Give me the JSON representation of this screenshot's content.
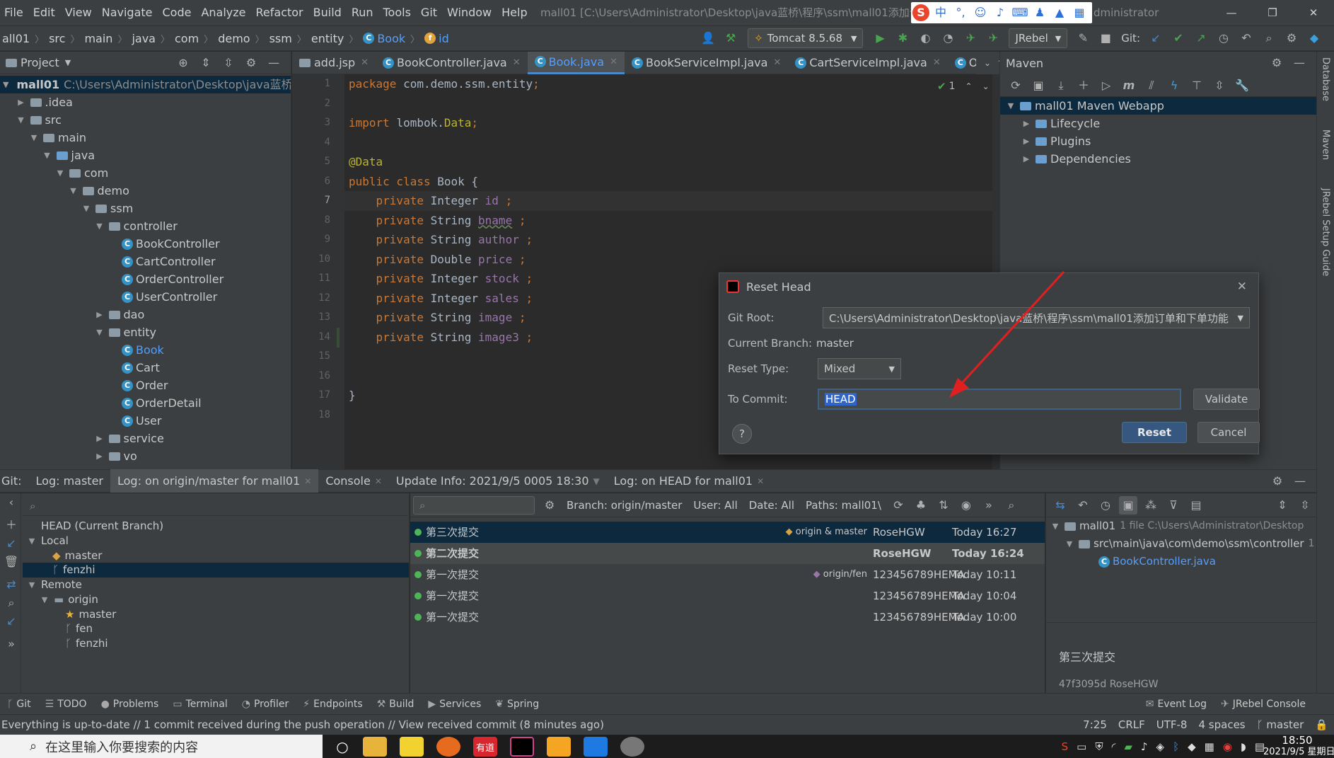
{
  "menubar": {
    "items": [
      "File",
      "Edit",
      "View",
      "Navigate",
      "Code",
      "Analyze",
      "Refactor",
      "Build",
      "Run",
      "Tools",
      "Git",
      "Window",
      "Help"
    ],
    "title": "mall01 [C:\\Users\\Administrator\\Desktop\\java蓝桥\\程序\\ssm\\mall01添加订",
    "title_tail": "dministrator",
    "ime": {
      "logo": "S",
      "lang": "中",
      "punct": "°,"
    }
  },
  "navbar": {
    "crumbs": [
      "all01",
      "src",
      "main",
      "java",
      "com",
      "demo",
      "ssm",
      "entity",
      "Book",
      "id"
    ],
    "run_config": "Tomcat 8.5.68",
    "jrebel": "JRebel",
    "git_label": "Git:"
  },
  "project": {
    "header": "Project",
    "tree": [
      {
        "label": "mall01",
        "path": "C:\\Users\\Administrator\\Desktop\\java蓝桥\\",
        "level": 0,
        "arrow": "▼",
        "kind": "folder",
        "selected": true,
        "bold": true
      },
      {
        "label": ".idea",
        "level": 1,
        "arrow": "▶",
        "kind": "folder"
      },
      {
        "label": "src",
        "level": 1,
        "arrow": "▼",
        "kind": "folder"
      },
      {
        "label": "main",
        "level": 2,
        "arrow": "▼",
        "kind": "folder"
      },
      {
        "label": "java",
        "level": 3,
        "arrow": "▼",
        "kind": "folder-blue"
      },
      {
        "label": "com",
        "level": 4,
        "arrow": "▼",
        "kind": "folder"
      },
      {
        "label": "demo",
        "level": 5,
        "arrow": "▼",
        "kind": "folder"
      },
      {
        "label": "ssm",
        "level": 6,
        "arrow": "▼",
        "kind": "folder"
      },
      {
        "label": "controller",
        "level": 7,
        "arrow": "▼",
        "kind": "folder"
      },
      {
        "label": "BookController",
        "level": 8,
        "arrow": "",
        "kind": "class"
      },
      {
        "label": "CartController",
        "level": 8,
        "arrow": "",
        "kind": "class"
      },
      {
        "label": "OrderController",
        "level": 8,
        "arrow": "",
        "kind": "class"
      },
      {
        "label": "UserController",
        "level": 8,
        "arrow": "",
        "kind": "class"
      },
      {
        "label": "dao",
        "level": 7,
        "arrow": "▶",
        "kind": "folder"
      },
      {
        "label": "entity",
        "level": 7,
        "arrow": "▼",
        "kind": "folder"
      },
      {
        "label": "Book",
        "level": 8,
        "arrow": "",
        "kind": "class",
        "blue": true
      },
      {
        "label": "Cart",
        "level": 8,
        "arrow": "",
        "kind": "class"
      },
      {
        "label": "Order",
        "level": 8,
        "arrow": "",
        "kind": "class"
      },
      {
        "label": "OrderDetail",
        "level": 8,
        "arrow": "",
        "kind": "class"
      },
      {
        "label": "User",
        "level": 8,
        "arrow": "",
        "kind": "class"
      },
      {
        "label": "service",
        "level": 7,
        "arrow": "▶",
        "kind": "folder"
      },
      {
        "label": "vo",
        "level": 7,
        "arrow": "▶",
        "kind": "folder"
      }
    ]
  },
  "editor": {
    "tabs": [
      {
        "label": "add.jsp",
        "active": false
      },
      {
        "label": "BookController.java",
        "active": false
      },
      {
        "label": "Book.java",
        "active": true
      },
      {
        "label": "BookServiceImpl.java",
        "active": false
      },
      {
        "label": "CartServiceImpl.java",
        "active": false
      },
      {
        "label": "Order",
        "active": false
      }
    ],
    "inspection_count": "1",
    "lines": [
      {
        "n": "1",
        "parts": [
          [
            "kw",
            "package "
          ],
          [
            "",
            "com.demo.ssm.entity"
          ],
          [
            "kw",
            ";"
          ]
        ]
      },
      {
        "n": "2",
        "parts": []
      },
      {
        "n": "3",
        "parts": [
          [
            "kw",
            "import "
          ],
          [
            "",
            "lombok."
          ],
          [
            "ann",
            "Data"
          ],
          [
            "kw",
            ";"
          ]
        ]
      },
      {
        "n": "4",
        "parts": []
      },
      {
        "n": "5",
        "parts": [
          [
            "ann",
            "@Data"
          ]
        ]
      },
      {
        "n": "6",
        "parts": [
          [
            "kw",
            "public class "
          ],
          [
            "",
            "Book {"
          ]
        ]
      },
      {
        "n": "7",
        "parts": [
          [
            "kw",
            "    private "
          ],
          [
            "",
            "Integer "
          ],
          [
            "fld",
            "id "
          ],
          [
            "kw",
            ";"
          ]
        ],
        "current": true
      },
      {
        "n": "8",
        "parts": [
          [
            "kw",
            "    private "
          ],
          [
            "",
            "String "
          ],
          [
            "fld sq",
            "bname"
          ],
          [
            "kw",
            " ;"
          ]
        ]
      },
      {
        "n": "9",
        "parts": [
          [
            "kw",
            "    private "
          ],
          [
            "",
            "String "
          ],
          [
            "fld",
            "author "
          ],
          [
            "kw",
            ";"
          ]
        ]
      },
      {
        "n": "10",
        "parts": [
          [
            "kw",
            "    private "
          ],
          [
            "",
            "Double "
          ],
          [
            "fld",
            "price "
          ],
          [
            "kw",
            ";"
          ]
        ]
      },
      {
        "n": "11",
        "parts": [
          [
            "kw",
            "    private "
          ],
          [
            "",
            "Integer "
          ],
          [
            "fld",
            "stock "
          ],
          [
            "kw",
            ";"
          ]
        ]
      },
      {
        "n": "12",
        "parts": [
          [
            "kw",
            "    private "
          ],
          [
            "",
            "Integer "
          ],
          [
            "fld",
            "sales "
          ],
          [
            "kw",
            ";"
          ]
        ]
      },
      {
        "n": "13",
        "parts": [
          [
            "kw",
            "    private "
          ],
          [
            "",
            "String "
          ],
          [
            "fld",
            "image "
          ],
          [
            "kw",
            ";"
          ]
        ]
      },
      {
        "n": "14",
        "parts": [
          [
            "kw",
            "    private "
          ],
          [
            "",
            "String "
          ],
          [
            "fld",
            "image3 "
          ],
          [
            "kw",
            ";"
          ]
        ]
      },
      {
        "n": "15",
        "parts": []
      },
      {
        "n": "16",
        "parts": []
      },
      {
        "n": "17",
        "parts": [
          [
            "",
            "}"
          ]
        ]
      },
      {
        "n": "18",
        "parts": []
      }
    ]
  },
  "maven": {
    "title": "Maven",
    "tree": [
      {
        "label": "mall01 Maven Webapp",
        "arrow": "▼",
        "level": 0,
        "selected": true
      },
      {
        "label": "Lifecycle",
        "arrow": "▶",
        "level": 1
      },
      {
        "label": "Plugins",
        "arrow": "▶",
        "level": 1
      },
      {
        "label": "Dependencies",
        "arrow": "▶",
        "level": 1
      }
    ]
  },
  "right_strip": [
    "Database",
    "Maven",
    "JRebel Setup Guide"
  ],
  "dialog": {
    "title": "Reset Head",
    "git_root_label": "Git Root:",
    "git_root_value": "C:\\Users\\Administrator\\Desktop\\java蓝桥\\程序\\ssm\\mall01添加订单和下单功能",
    "branch_label": "Current Branch:",
    "branch_value": "master",
    "reset_type_label": "Reset Type:",
    "reset_type_value": "Mixed",
    "commit_label": "To Commit:",
    "commit_value": "HEAD",
    "validate": "Validate",
    "reset": "Reset",
    "cancel": "Cancel",
    "help": "?"
  },
  "git": {
    "tabs": [
      {
        "label": "Git:",
        "closable": false,
        "active": false
      },
      {
        "label": "Log: master",
        "closable": false,
        "active": false
      },
      {
        "label": "Log: on origin/master for mall01",
        "closable": true,
        "active": true
      },
      {
        "label": "Console",
        "closable": true,
        "active": false
      },
      {
        "label": "Update Info: 2021/9/5 0005 18:30",
        "closable": false,
        "active": false,
        "dropdown": true
      },
      {
        "label": "Log: on HEAD for mall01",
        "closable": true,
        "active": false
      }
    ],
    "branches": [
      {
        "label": "HEAD (Current Branch)",
        "level": 0,
        "arrow": ""
      },
      {
        "label": "Local",
        "level": 0,
        "arrow": "▼"
      },
      {
        "label": "master",
        "level": 2,
        "arrow": "",
        "icon": "tag"
      },
      {
        "label": "fenzhi",
        "level": 2,
        "arrow": "",
        "icon": "branch",
        "selected": true
      },
      {
        "label": "Remote",
        "level": 0,
        "arrow": "▼"
      },
      {
        "label": "origin",
        "level": 1,
        "arrow": "▼",
        "icon": "folder"
      },
      {
        "label": "master",
        "level": 3,
        "arrow": "",
        "icon": "star"
      },
      {
        "label": "fen",
        "level": 3,
        "arrow": "",
        "icon": "branch"
      },
      {
        "label": "fenzhi",
        "level": 3,
        "arrow": "",
        "icon": "branch"
      }
    ],
    "filters": {
      "branch": "Branch: origin/master",
      "user": "User: All",
      "date": "Date: All",
      "paths": "Paths: mall01\\"
    },
    "log": [
      {
        "msg": "第三次提交",
        "refs": "origin & master",
        "author": "RoseHGW",
        "date": "Today 16:27",
        "style": "selected"
      },
      {
        "msg": "第二次提交",
        "refs": "",
        "author": "RoseHGW",
        "date": "Today 16:24",
        "style": "bold"
      },
      {
        "msg": "第一次提交",
        "refs": "origin/fen",
        "author": "123456789HEMA",
        "date": "Today 10:11",
        "style": ""
      },
      {
        "msg": "第一次提交",
        "refs": "",
        "author": "123456789HEMA",
        "date": "Today 10:04",
        "style": ""
      },
      {
        "msg": "第一次提交",
        "refs": "",
        "author": "123456789HEMA",
        "date": "Today 10:00",
        "style": ""
      }
    ],
    "details": {
      "root": "mall01",
      "root_info": "1 file  C:\\Users\\Administrator\\Desktop",
      "folder": "src\\main\\java\\com\\demo\\ssm\\controller",
      "folder_count": "1",
      "file": "BookController.java",
      "commit_msg": "第三次提交",
      "commit_hash": "47f3095d RoseHGW"
    }
  },
  "toolwindows": {
    "left": [
      "Git",
      "TODO",
      "Problems",
      "Terminal",
      "Profiler",
      "Endpoints",
      "Build",
      "Services",
      "Spring"
    ],
    "right": [
      "Event Log",
      "JRebel Console"
    ]
  },
  "status": {
    "message": "Everything is up-to-date // 1 commit received during the push operation // View received commit (8 minutes ago)",
    "position": "7:25",
    "line_sep": "CRLF",
    "encoding": "UTF-8",
    "indent": "4 spaces",
    "branch": "master"
  },
  "taskbar": {
    "search_placeholder": "在这里输入你要搜索的内容",
    "youdao": "有道",
    "time": "18:50",
    "date": "2021/9/5 星期日"
  }
}
